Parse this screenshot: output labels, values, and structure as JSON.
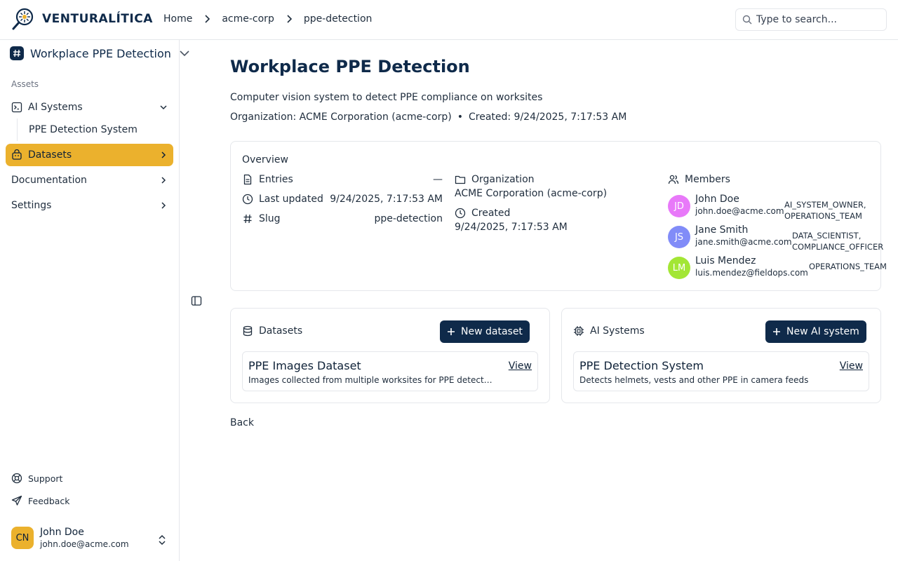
{
  "brand": {
    "name": "VENTURALÍTICA"
  },
  "breadcrumb": [
    "Home",
    "acme-corp",
    "ppe-detection"
  ],
  "search": {
    "placeholder": "Type to search..."
  },
  "sidebar": {
    "workspace": "Workplace PPE Detection",
    "group_label": "Assets",
    "items": [
      {
        "label": "AI Systems",
        "icon": "terminal-icon",
        "expanded": true
      },
      {
        "label": "Datasets",
        "icon": "database-icon",
        "active": true
      },
      {
        "label": "Documentation"
      },
      {
        "label": "Settings"
      }
    ],
    "sub_items": [
      "PPE Detection System"
    ],
    "support": "Support",
    "feedback": "Feedback",
    "user": {
      "initials": "CN",
      "name": "John Doe",
      "email": "john.doe@acme.com"
    }
  },
  "page": {
    "title": "Workplace PPE Detection",
    "description": "Computer vision system to detect PPE compliance on worksites",
    "meta_org": "Organization: ACME Corporation (acme-corp)",
    "meta_sep": "•",
    "meta_created": "Created: 9/24/2025, 7:17:53 AM"
  },
  "overview": {
    "title": "Overview",
    "entries_label": "Entries",
    "entries_value": "—",
    "last_updated_label": "Last updated",
    "last_updated_value": "9/24/2025, 7:17:53 AM",
    "slug_label": "Slug",
    "slug_value": "ppe-detection",
    "organization_label": "Organization",
    "organization_value": "ACME Corporation (acme-corp)",
    "created_label": "Created",
    "created_value": "9/24/2025, 7:17:53 AM",
    "members_label": "Members",
    "members": [
      {
        "initials": "JD",
        "name": "John Doe",
        "email": "john.doe@acme.com",
        "roles": [
          "AI_SYSTEM_OWNER,",
          "OPERATIONS_TEAM"
        ],
        "color": "#e879f9"
      },
      {
        "initials": "JS",
        "name": "Jane Smith",
        "email": "jane.smith@acme.com",
        "roles": [
          "DATA_SCIENTIST,",
          "COMPLIANCE_OFFICER"
        ],
        "color": "#818cf8"
      },
      {
        "initials": "LM",
        "name": "Luis Mendez",
        "email": "luis.mendez@fieldops.com",
        "roles": [
          "OPERATIONS_TEAM"
        ],
        "color": "#a3e635"
      }
    ]
  },
  "datasets": {
    "title": "Datasets",
    "new_label": "New dataset",
    "items": [
      {
        "title": "PPE Images Dataset",
        "description": "Images collected from multiple worksites for PPE detection training",
        "view": "View"
      }
    ]
  },
  "ai_systems": {
    "title": "AI Systems",
    "new_label": "New AI system",
    "items": [
      {
        "title": "PPE Detection System",
        "description": "Detects helmets, vests and other PPE in camera feeds",
        "view": "View"
      }
    ]
  },
  "back_label": "Back",
  "colors": {
    "primary": "#0f2a4a",
    "accent": "#ebb12d",
    "border": "#e5e7eb"
  }
}
